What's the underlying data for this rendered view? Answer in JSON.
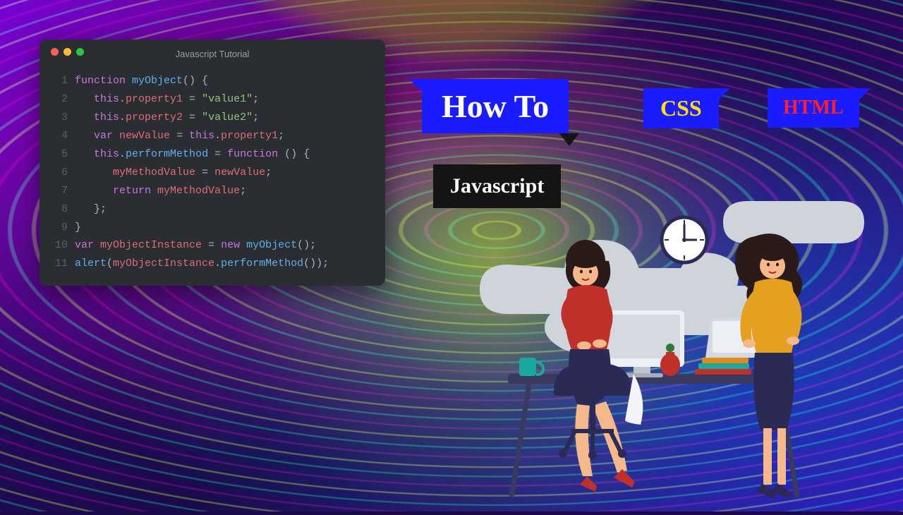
{
  "editor": {
    "title": "Javascript Tutorial",
    "lines": [
      {
        "n": "1",
        "tokens": [
          [
            "kw",
            "function"
          ],
          [
            "op",
            " "
          ],
          [
            "fn",
            "myObject"
          ],
          [
            "op",
            "() {"
          ]
        ]
      },
      {
        "n": "2",
        "tokens": [
          [
            "op",
            "   "
          ],
          [
            "kw",
            "this"
          ],
          [
            "op",
            "."
          ],
          [
            "prop",
            "property1"
          ],
          [
            "op",
            " = "
          ],
          [
            "str",
            "\"value1\""
          ],
          [
            "op",
            ";"
          ]
        ]
      },
      {
        "n": "3",
        "tokens": [
          [
            "op",
            "   "
          ],
          [
            "kw",
            "this"
          ],
          [
            "op",
            "."
          ],
          [
            "prop",
            "property2"
          ],
          [
            "op",
            " = "
          ],
          [
            "str",
            "\"value2\""
          ],
          [
            "op",
            ";"
          ]
        ]
      },
      {
        "n": "4",
        "tokens": [
          [
            "op",
            "   "
          ],
          [
            "kw",
            "var"
          ],
          [
            "op",
            " "
          ],
          [
            "prop",
            "newValue"
          ],
          [
            "op",
            " = "
          ],
          [
            "kw",
            "this"
          ],
          [
            "op",
            "."
          ],
          [
            "prop",
            "property1"
          ],
          [
            "op",
            ";"
          ]
        ]
      },
      {
        "n": "5",
        "tokens": [
          [
            "op",
            "   "
          ],
          [
            "kw",
            "this"
          ],
          [
            "op",
            "."
          ],
          [
            "fn",
            "performMethod"
          ],
          [
            "op",
            " = "
          ],
          [
            "kw",
            "function"
          ],
          [
            "op",
            " () {"
          ]
        ]
      },
      {
        "n": "6",
        "tokens": [
          [
            "op",
            "      "
          ],
          [
            "prop",
            "myMethodValue"
          ],
          [
            "op",
            " = "
          ],
          [
            "prop",
            "newValue"
          ],
          [
            "op",
            ";"
          ]
        ]
      },
      {
        "n": "7",
        "tokens": [
          [
            "op",
            "      "
          ],
          [
            "kw",
            "return"
          ],
          [
            "op",
            " "
          ],
          [
            "prop",
            "myMethodValue"
          ],
          [
            "op",
            ";"
          ]
        ]
      },
      {
        "n": "8",
        "tokens": [
          [
            "op",
            "   };"
          ]
        ]
      },
      {
        "n": "9",
        "tokens": [
          [
            "op",
            "}"
          ]
        ]
      },
      {
        "n": "10",
        "tokens": [
          [
            "kw",
            "var"
          ],
          [
            "op",
            " "
          ],
          [
            "prop",
            "myObjectInstance"
          ],
          [
            "op",
            " = "
          ],
          [
            "kw",
            "new"
          ],
          [
            "op",
            " "
          ],
          [
            "fn",
            "myObject"
          ],
          [
            "op",
            "();"
          ]
        ]
      },
      {
        "n": "11",
        "tokens": [
          [
            "fn",
            "alert"
          ],
          [
            "op",
            "("
          ],
          [
            "prop",
            "myObjectInstance"
          ],
          [
            "op",
            "."
          ],
          [
            "fn",
            "performMethod"
          ],
          [
            "op",
            "());"
          ]
        ]
      }
    ]
  },
  "tags": {
    "howto": "How To",
    "css": "CSS",
    "html": "HTML",
    "js": "Javascript"
  }
}
